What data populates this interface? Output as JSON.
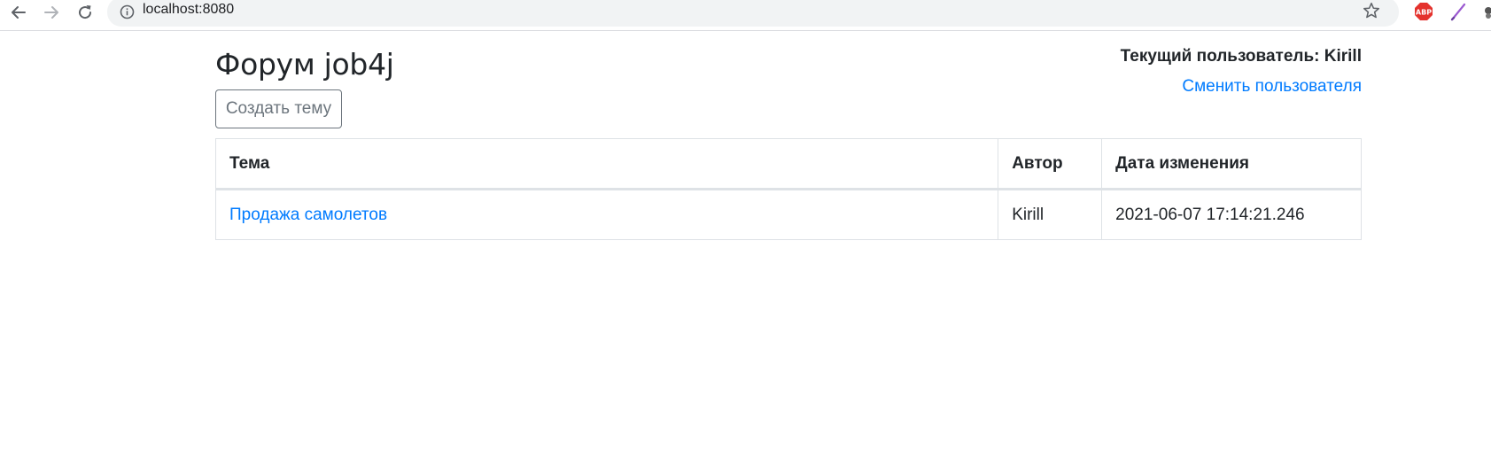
{
  "browser": {
    "url": "localhost:8080"
  },
  "header": {
    "title": "Форум job4j",
    "current_user_label": "Текущий пользователь: Kirill",
    "switch_user_link": "Сменить пользователя",
    "create_topic_button": "Создать тему"
  },
  "table": {
    "columns": [
      "Тема",
      "Автор",
      "Дата изменения"
    ],
    "rows": [
      {
        "topic": "Продажа самолетов",
        "author": "Kirill",
        "modified": "2021-06-07 17:14:21.246"
      }
    ]
  },
  "icons": {
    "back": "arrow-left-icon",
    "forward": "arrow-right-icon",
    "reload": "reload-icon",
    "site_info": "info-circle-icon",
    "bookmark": "star-icon",
    "adblock": "abp-icon",
    "pen": "pen-icon"
  },
  "colors": {
    "link": "#007bff",
    "text": "#212529",
    "border": "#dee2e6",
    "button_outline": "#6c757d",
    "abp_red": "#e4322d"
  }
}
